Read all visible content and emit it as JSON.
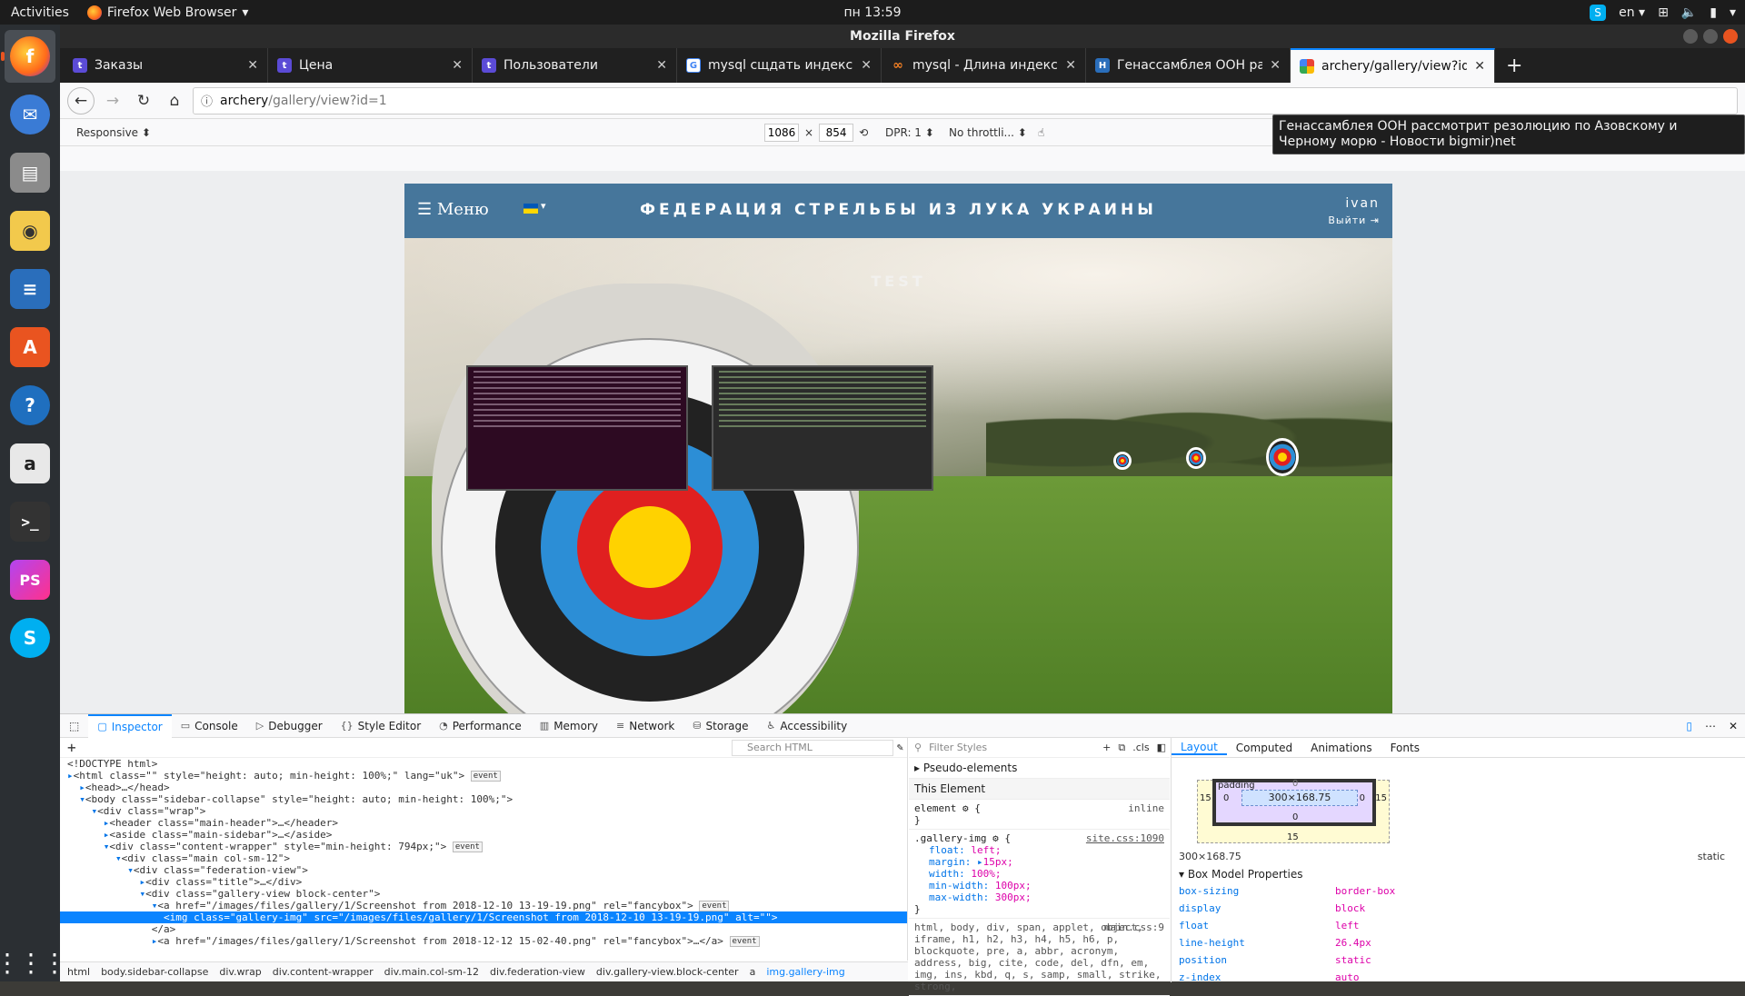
{
  "topbar": {
    "activities": "Activities",
    "app_name": "Firefox Web Browser",
    "clock": "пн 13:59",
    "keyboard_layout": "en"
  },
  "dock": {
    "items": [
      {
        "name": "firefox",
        "icon": "firefox-icon",
        "color": "#ff7139",
        "active": true
      },
      {
        "name": "thunderbird",
        "icon": "mail-icon",
        "color": "#3a7bd5"
      },
      {
        "name": "files",
        "icon": "files-icon",
        "color": "#8b8b8b"
      },
      {
        "name": "rhythmbox",
        "icon": "music-icon",
        "color": "#f2c94c"
      },
      {
        "name": "writer",
        "icon": "document-icon",
        "color": "#2a6ebb"
      },
      {
        "name": "software",
        "icon": "store-icon",
        "color": "#e95420"
      },
      {
        "name": "help",
        "icon": "help-icon",
        "color": "#1f6fbf"
      },
      {
        "name": "amazon",
        "icon": "amazon-icon",
        "color": "#e8e8e8"
      },
      {
        "name": "terminal",
        "icon": "terminal-icon",
        "color": "#333333"
      },
      {
        "name": "phpstorm",
        "icon": "phpstorm-icon",
        "color": "#b345f1"
      },
      {
        "name": "skype",
        "icon": "skype-icon",
        "color": "#00aff0"
      }
    ]
  },
  "window": {
    "title": "Mozilla Firefox"
  },
  "tabs": [
    {
      "title": "Заказы",
      "favicon_color": "#5b4bd6",
      "favicon_glyph": "t"
    },
    {
      "title": "Цена",
      "favicon_color": "#5b4bd6",
      "favicon_glyph": "t"
    },
    {
      "title": "Пользователи",
      "favicon_color": "#5b4bd6",
      "favicon_glyph": "t"
    },
    {
      "title": "mysql сщдать индекс с",
      "favicon_color": "#4285f4",
      "favicon_glyph": "G"
    },
    {
      "title": "mysql - Длина индекса",
      "favicon_color": "#f48024",
      "favicon_glyph": "∞"
    },
    {
      "title": "Генассамблея ООН рас",
      "favicon_color": "#2a6ebb",
      "favicon_glyph": "H"
    },
    {
      "title": "archery/gallery/view?id=",
      "favicon_color": "#ea4335",
      "favicon_glyph": "■",
      "selected": true
    }
  ],
  "urlbar": {
    "host": "archery",
    "path": "/gallery/view?id=1"
  },
  "tooltip": "Генассамблея ООН рассмотрит резолюцию по Азовскому и Черному морю - Новости bigmir)net",
  "rdm": {
    "mode": "Responsive",
    "width": "1086",
    "height": "854",
    "dpr": "DPR: 1",
    "throttling": "No throttli..."
  },
  "site": {
    "menu": "☰ Меню",
    "brand": "ФЕДЕРАЦИЯ СТРЕЛЬБЫ ИЗ ЛУКА УКРАИНЫ",
    "user": "ivan",
    "logout": "Выйти",
    "gallery_title": "TEST"
  },
  "devtools": {
    "tabs": [
      "Inspector",
      "Console",
      "Debugger",
      "Style Editor",
      "Performance",
      "Memory",
      "Network",
      "Storage",
      "Accessibility"
    ],
    "search_html": "Search HTML",
    "filter_styles": "Filter Styles",
    "cls": ".cls",
    "markup": [
      "<!DOCTYPE html>",
      "<html class=\"\" style=\"height: auto; min-height: 100%;\" lang=\"uk\">",
      "<head>…</head>",
      "<body class=\"sidebar-collapse\" style=\"height: auto; min-height: 100%;\">",
      "<div class=\"wrap\">",
      "<header class=\"main-header\">…</header>",
      "<aside class=\"main-sidebar\">…</aside>",
      "<div class=\"content-wrapper\" style=\"min-height: 794px;\">",
      "<div class=\"main col-sm-12\">",
      "<div class=\"federation-view\">",
      "<div class=\"title\">…</div>",
      "<div class=\"gallery-view block-center\">",
      "<a href=\"/images/files/gallery/1/Screenshot from 2018-12-10 13-19-19.png\" rel=\"fancybox\">",
      "<img class=\"gallery-img\" src=\"/images/files/gallery/1/Screenshot from 2018-12-10 13-19-19.png\" alt=\"\">",
      "</a>",
      "<a href=\"/images/files/gallery/1/Screenshot from 2018-12-12 15-02-40.png\" rel=\"fancybox\">…</a>"
    ],
    "event_badge": "event",
    "breadcrumbs": [
      "html",
      "body.sidebar-collapse",
      "div.wrap",
      "div.content-wrapper",
      "div.main.col-sm-12",
      "div.federation-view",
      "div.gallery-view.block-center",
      "a",
      "img.gallery-img"
    ],
    "rules": {
      "pseudo": "Pseudo-elements",
      "this_element": "This Element",
      "element_selector": "element",
      "element_source": "inline",
      "selector": ".gallery-img",
      "source": "site.css:1090",
      "declarations": [
        {
          "prop": "float",
          "value": "left;"
        },
        {
          "prop": "margin",
          "value": "15px;"
        },
        {
          "prop": "width",
          "value": "100%;"
        },
        {
          "prop": "min-width",
          "value": "100px;"
        },
        {
          "prop": "max-width",
          "value": "300px;"
        }
      ],
      "reset_selector": "html, body, div, span, applet, object, iframe, h1, h2, h3, h4, h5, h6, p, blockquote, pre, a, abbr, acronym, address, big, cite, code, del, dfn, em, img, ins, kbd, q, s, samp, small, strike, strong,",
      "reset_source": "main.css:9"
    },
    "layout": {
      "tabs": [
        "Layout",
        "Computed",
        "Animations",
        "Fonts"
      ],
      "padding_label": "padding",
      "content_size": "300×168.75",
      "margin_value": "15",
      "padding_value": "0",
      "border_value": "0",
      "summary_size": "300×168.75",
      "summary_position": "static",
      "box_model_title": "Box Model Properties",
      "props": [
        {
          "k": "box-sizing",
          "v": "border-box"
        },
        {
          "k": "display",
          "v": "block"
        },
        {
          "k": "float",
          "v": "left"
        },
        {
          "k": "line-height",
          "v": "26.4px"
        },
        {
          "k": "position",
          "v": "static"
        },
        {
          "k": "z-index",
          "v": "auto"
        }
      ]
    }
  }
}
